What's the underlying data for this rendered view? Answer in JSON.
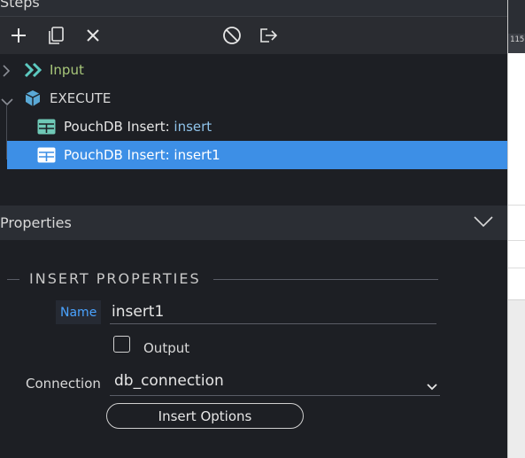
{
  "steps": {
    "title": "Steps",
    "toolbar": {
      "add_icon": "plus-icon",
      "copy_icon": "copy-icon",
      "delete_icon": "close-icon",
      "disable_icon": "disable-icon",
      "export_icon": "export-icon"
    },
    "tree": [
      {
        "label": "Input",
        "icon": "double-chevron-icon",
        "expanded": false
      },
      {
        "label": "EXECUTE",
        "icon": "cube-icon",
        "expanded": true
      },
      {
        "prefix": "PouchDB Insert: ",
        "name": "insert",
        "icon": "table-icon",
        "selected": false
      },
      {
        "prefix": "PouchDB Insert: ",
        "name": "insert1",
        "icon": "table-icon",
        "selected": true
      }
    ]
  },
  "properties": {
    "title": "Properties",
    "section_title": "INSERT PROPERTIES",
    "name_label": "Name",
    "name_value": "insert1",
    "output_label": "Output",
    "output_checked": false,
    "connection_label": "Connection",
    "connection_value": "db_connection",
    "insert_options_label": "Insert Options"
  },
  "right_panel": {
    "ruler_text": "115"
  },
  "colors": {
    "accent": "#3d8fe6",
    "input_label": "#a8c77a",
    "insert_name": "#8fc3ea",
    "name_label": "#4aa3ff"
  }
}
